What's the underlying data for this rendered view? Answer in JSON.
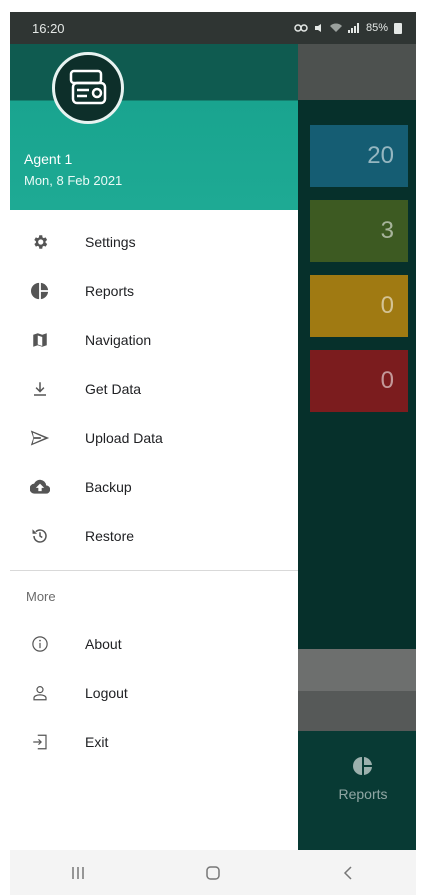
{
  "status_bar": {
    "time": "16:20",
    "battery": "85%"
  },
  "background": {
    "cards": [
      {
        "value": "20",
        "color": "#155d73"
      },
      {
        "value": "3",
        "color": "#3d5a22"
      },
      {
        "value": "0",
        "color": "#a07a12"
      },
      {
        "value": "0",
        "color": "#7b1c1e"
      }
    ],
    "bottom_tab": {
      "label": "Reports",
      "icon": "pie-chart-icon"
    }
  },
  "drawer": {
    "header": {
      "agent_name": "Agent 1",
      "date": "Mon, 8 Feb 2021",
      "color": "#1eaa94"
    },
    "items": [
      {
        "label": "Settings",
        "icon": "gear-icon"
      },
      {
        "label": "Reports",
        "icon": "pie-chart-icon"
      },
      {
        "label": "Navigation",
        "icon": "map-icon"
      },
      {
        "label": "Get Data",
        "icon": "download-icon"
      },
      {
        "label": "Upload Data",
        "icon": "send-icon"
      },
      {
        "label": "Backup",
        "icon": "cloud-upload-icon"
      },
      {
        "label": "Restore",
        "icon": "history-icon"
      }
    ],
    "section_title": "More",
    "more_items": [
      {
        "label": "About",
        "icon": "info-icon"
      },
      {
        "label": "Logout",
        "icon": "person-icon"
      },
      {
        "label": "Exit",
        "icon": "exit-icon"
      }
    ]
  },
  "nav_bar": {
    "buttons": [
      "recents-icon",
      "home-icon",
      "back-icon"
    ]
  }
}
